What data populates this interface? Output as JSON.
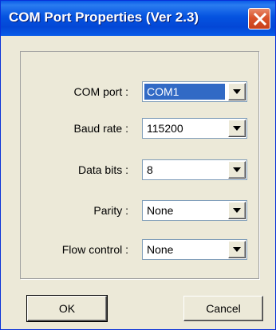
{
  "window": {
    "title": "COM Port Properties (Ver 2.3)"
  },
  "fields": [
    {
      "label": "COM port :",
      "value": "COM1",
      "selected": true
    },
    {
      "label": "Baud rate :",
      "value": "115200",
      "selected": false
    },
    {
      "label": "Data bits :",
      "value": "8",
      "selected": false
    },
    {
      "label": "Parity :",
      "value": "None",
      "selected": false
    },
    {
      "label": "Flow control :",
      "value": "None",
      "selected": false
    }
  ],
  "buttons": {
    "ok_label": "OK",
    "cancel_label": "Cancel"
  },
  "colors": {
    "titlebar": "#0553e0",
    "selection": "#316ac5",
    "close_button": "#d9532c",
    "dialog_face": "#ece9d8"
  },
  "icons": {
    "close": "close-icon",
    "dropdown": "chevron-down-icon"
  }
}
